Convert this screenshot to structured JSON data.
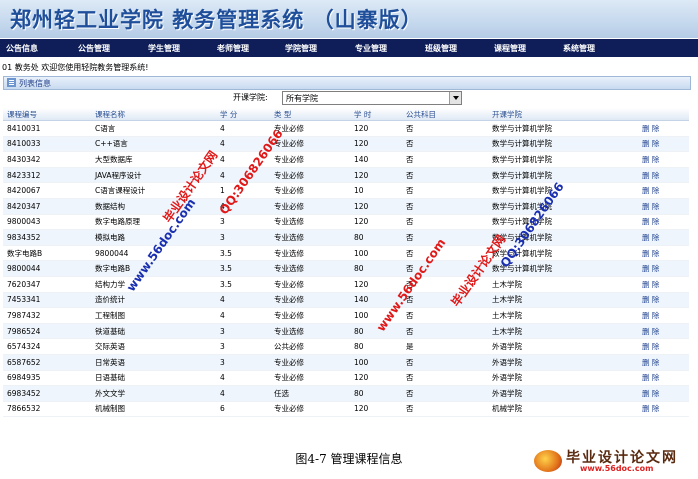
{
  "header": {
    "title": "郑州轻工业学院  教务管理系统 （山寨版）"
  },
  "nav": {
    "items": [
      "公告信息",
      "公告管理",
      "学生管理",
      "老师管理",
      "学院管理",
      "专业管理",
      "班级管理",
      "课程管理",
      "系统管理"
    ]
  },
  "welcome": "01 教务处 欢迎您使用轻院教务管理系统!",
  "panel": {
    "title": "列表信息"
  },
  "filter": {
    "label": "开课学院:",
    "selected": "所有学院"
  },
  "table": {
    "headers": [
      "课程编号",
      "课程名称",
      "学 分",
      "类 型",
      "学 时",
      "公共科目",
      "开课学院",
      ""
    ],
    "rows": [
      [
        "8410031",
        "C语言",
        "4",
        "专业必修",
        "120",
        "否",
        "数学与计算机学院",
        "删 除"
      ],
      [
        "8410033",
        "C++语言",
        "4",
        "专业必修",
        "120",
        "否",
        "数学与计算机学院",
        "删 除"
      ],
      [
        "8430342",
        "大型数据库",
        "4",
        "专业必修",
        "140",
        "否",
        "数学与计算机学院",
        "删 除"
      ],
      [
        "8423312",
        "JAVA程序设计",
        "4",
        "专业必修",
        "120",
        "否",
        "数学与计算机学院",
        "删 除"
      ],
      [
        "8420067",
        "C语言课程设计",
        "1",
        "专业必修",
        "10",
        "否",
        "数学与计算机学院",
        "删 除"
      ],
      [
        "8420347",
        "数据结构",
        "4",
        "专业必修",
        "120",
        "否",
        "数学与计算机学院",
        "删 除"
      ],
      [
        "9800043",
        "数字电路原理",
        "3",
        "专业选修",
        "120",
        "否",
        "数学与计算机学院",
        "删 除"
      ],
      [
        "9834352",
        "模拟电路",
        "3",
        "专业选修",
        "80",
        "否",
        "数学与计算机学院",
        "删 除"
      ],
      [
        "数字电路B",
        "9800044",
        "3.5",
        "专业选修",
        "100",
        "否",
        "数学与计算机学院",
        "删 除"
      ],
      [
        "9800044",
        "数字电路B",
        "3.5",
        "专业选修",
        "80",
        "否",
        "数学与计算机学院",
        "删 除"
      ],
      [
        "7620347",
        "结构力学",
        "3.5",
        "专业必修",
        "120",
        "否",
        "土木学院",
        "删 除"
      ],
      [
        "7453341",
        "造价统计",
        "4",
        "专业必修",
        "140",
        "否",
        "土木学院",
        "删 除"
      ],
      [
        "7987432",
        "工程制图",
        "4",
        "专业必修",
        "100",
        "否",
        "土木学院",
        "删 除"
      ],
      [
        "7986524",
        "铁道基础",
        "3",
        "专业选修",
        "80",
        "否",
        "土木学院",
        "删 除"
      ],
      [
        "6574324",
        "交际英语",
        "3",
        "公共必修",
        "80",
        "是",
        "外语学院",
        "删 除"
      ],
      [
        "6587652",
        "日常英语",
        "3",
        "专业必修",
        "100",
        "否",
        "外语学院",
        "删 除"
      ],
      [
        "6984935",
        "日语基础",
        "4",
        "专业必修",
        "120",
        "否",
        "外语学院",
        "删 除"
      ],
      [
        "6983452",
        "外文文学",
        "4",
        "任选",
        "80",
        "否",
        "外语学院",
        "删 除"
      ],
      [
        "7866532",
        "机械制图",
        "6",
        "专业必修",
        "120",
        "否",
        "机械学院",
        "删 除"
      ]
    ]
  },
  "watermarks": {
    "site": "www.56doc.com",
    "title": "毕业设计论文网",
    "qq": "QQ:306826066"
  },
  "caption": "图4-7  管理课程信息",
  "logo": {
    "title": "毕业设计论文网",
    "url": "www.56doc.com"
  },
  "colors": {
    "nav_bg": "#0f1e58",
    "header_text": "#1f4f9a",
    "watermark_red": "#e01818",
    "watermark_blue": "#1a2fb0"
  }
}
